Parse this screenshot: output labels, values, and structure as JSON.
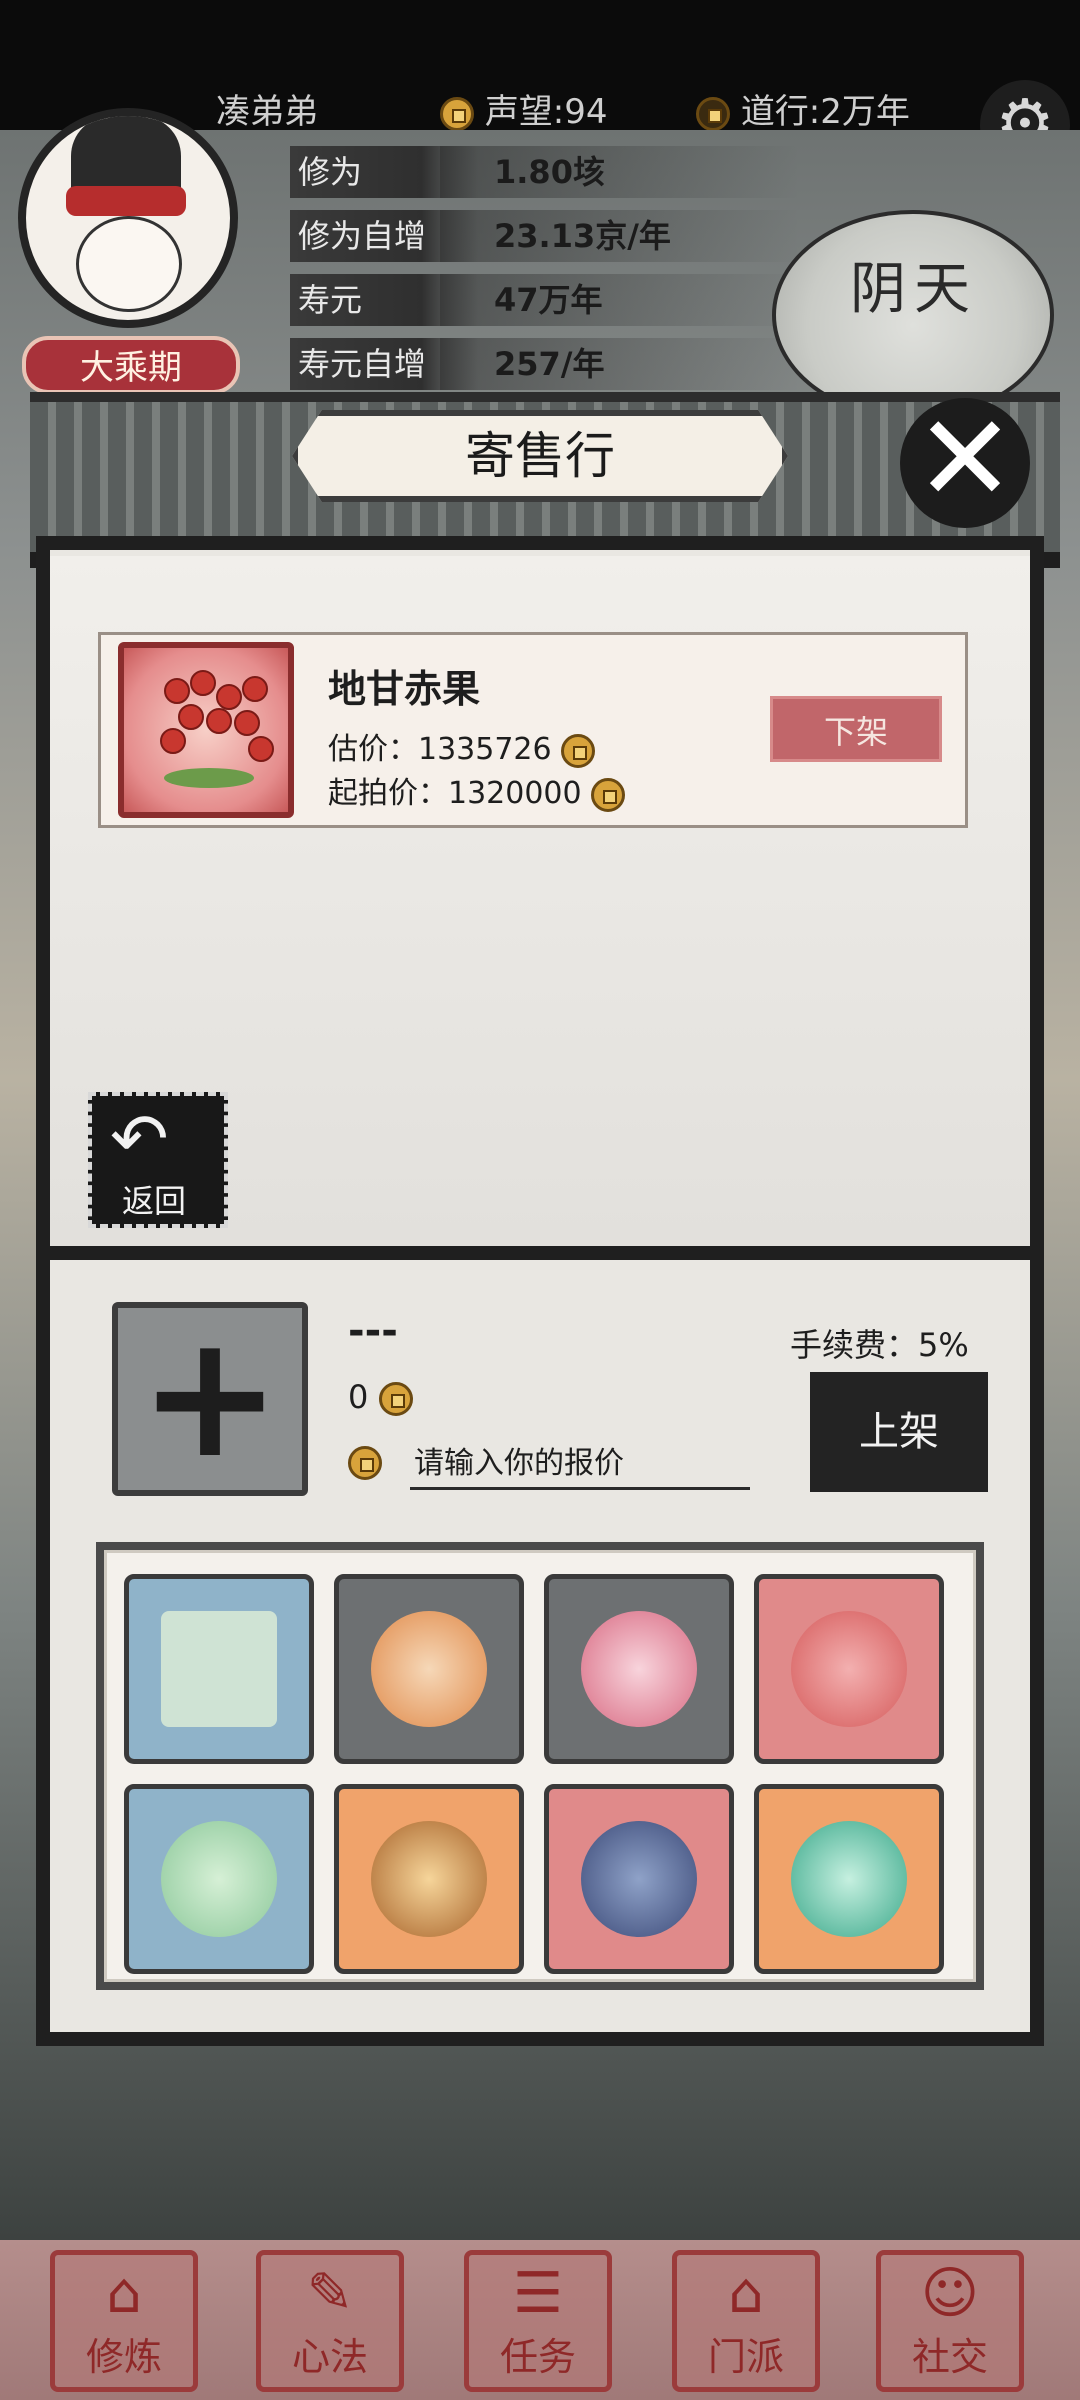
{
  "top_bar": {
    "player_name": "凑弟弟",
    "reputation": "声望:94",
    "daoxing": "道行:2万年"
  },
  "player": {
    "realm_badge": "大乘期"
  },
  "stats": [
    {
      "label": "修为",
      "value": "1.80垓"
    },
    {
      "label": "修为自增",
      "value": "23.13京/年"
    },
    {
      "label": "寿元",
      "value": "47万年"
    },
    {
      "label": "寿元自增",
      "value": "257/年"
    }
  ],
  "weather": "阴天",
  "dialog": {
    "title": "寄售行"
  },
  "listing": {
    "name": "地甘赤果",
    "estimate_label": "估价：1335726",
    "start_price_label": "起拍价：1320000",
    "remove_label": "下架"
  },
  "back": {
    "label": "返回",
    "arrow": "↶"
  },
  "sell": {
    "plus": "+",
    "item_name": "---",
    "amount": "0",
    "input_placeholder": "请输入你的报价",
    "fee_label": "手续费：5%",
    "list_label": "上架"
  },
  "inventory": [
    {
      "icon": "scroll-icon",
      "bg": "#8fb3c9"
    },
    {
      "icon": "orange-swirl-orb-icon",
      "bg": "#6d7072"
    },
    {
      "icon": "pink-swirl-orb-icon",
      "bg": "#6d7072"
    },
    {
      "icon": "red-flower-herb-icon",
      "bg": "#e08a8a"
    },
    {
      "icon": "jade-ruyi-scepter-icon",
      "bg": "#8fb3c9"
    },
    {
      "icon": "bronze-lantern-icon",
      "bg": "#f0a36b"
    },
    {
      "icon": "blue-incense-burner-icon",
      "bg": "#e08a8a"
    },
    {
      "icon": "jade-dragon-icon",
      "bg": "#f0a36b"
    }
  ],
  "nav": [
    {
      "label": "修炼",
      "glyph": "⌂"
    },
    {
      "label": "心法",
      "glyph": "✎"
    },
    {
      "label": "任务",
      "glyph": "☰"
    },
    {
      "label": "门派",
      "glyph": "⌂"
    },
    {
      "label": "社交",
      "glyph": "☺"
    }
  ]
}
